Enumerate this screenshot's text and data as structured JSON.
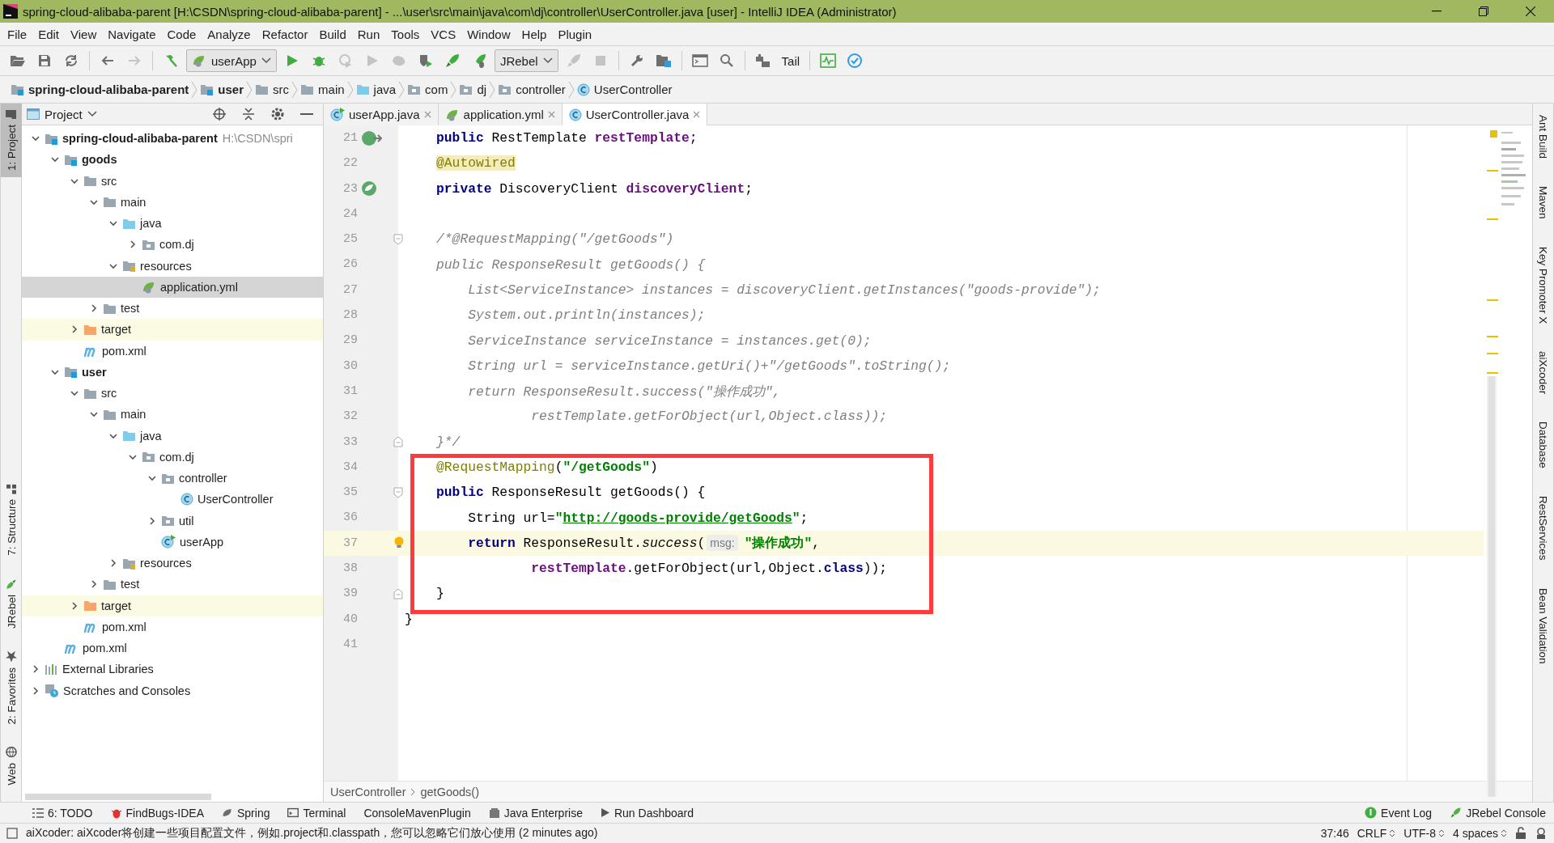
{
  "window": {
    "title": "spring-cloud-alibaba-parent [H:\\CSDN\\spring-cloud-alibaba-parent] - ...\\user\\src\\main\\java\\com\\dj\\controller\\UserController.java [user] - IntelliJ IDEA (Administrator)"
  },
  "menu": [
    "File",
    "Edit",
    "View",
    "Navigate",
    "Code",
    "Analyze",
    "Refactor",
    "Build",
    "Run",
    "Tools",
    "VCS",
    "Window",
    "Help",
    "Plugin"
  ],
  "toolbar": [
    {
      "kind": "open",
      "disabled": false
    },
    {
      "kind": "save",
      "disabled": false
    },
    {
      "kind": "sync",
      "disabled": false
    },
    {
      "kind": "separator"
    },
    {
      "kind": "back",
      "disabled": false
    },
    {
      "kind": "forward",
      "disabled": true
    },
    {
      "kind": "separator"
    },
    {
      "kind": "build",
      "disabled": false
    },
    {
      "kind": "combo",
      "label": "userApp"
    },
    {
      "kind": "run",
      "disabled": false
    },
    {
      "kind": "debug",
      "disabled": false
    },
    {
      "kind": "coverage",
      "disabled": true
    },
    {
      "kind": "run",
      "disabled": true
    },
    {
      "kind": "profile",
      "disabled": true
    },
    {
      "kind": "attach",
      "disabled": false
    },
    {
      "kind": "rocket",
      "disabled": false
    },
    {
      "kind": "rocket-bug",
      "disabled": false
    },
    {
      "kind": "combo",
      "label": "JRebel"
    },
    {
      "kind": "rocket",
      "disabled": true
    },
    {
      "kind": "stop",
      "disabled": true
    },
    {
      "kind": "separator"
    },
    {
      "kind": "wrench",
      "disabled": false
    },
    {
      "kind": "structure",
      "disabled": false
    },
    {
      "kind": "separator"
    },
    {
      "kind": "terminal",
      "disabled": false
    },
    {
      "kind": "search",
      "disabled": false
    },
    {
      "kind": "separator"
    },
    {
      "kind": "vcs",
      "disabled": false
    },
    {
      "kind": "text",
      "label": "Tail"
    },
    {
      "kind": "separator"
    },
    {
      "kind": "monitor",
      "disabled": false
    },
    {
      "kind": "check",
      "disabled": false
    }
  ],
  "breadcrumbs": [
    {
      "label": "spring-cloud-alibaba-parent",
      "kind": "module",
      "bold": true
    },
    {
      "label": "user",
      "kind": "module",
      "bold": true
    },
    {
      "label": "src",
      "kind": "folder",
      "bold": false
    },
    {
      "label": "main",
      "kind": "folder",
      "bold": false
    },
    {
      "label": "java",
      "kind": "source",
      "bold": false
    },
    {
      "label": "com",
      "kind": "package",
      "bold": false
    },
    {
      "label": "dj",
      "kind": "package",
      "bold": false
    },
    {
      "label": "controller",
      "kind": "package",
      "bold": false
    },
    {
      "label": "UserController",
      "kind": "class",
      "bold": false
    }
  ],
  "left_stripe": [
    {
      "label": "1: Project",
      "selected": true,
      "kind": "folder"
    },
    {
      "label": "7: Structure",
      "selected": false,
      "kind": "structure"
    },
    {
      "label": "JRebel",
      "selected": false,
      "kind": "rocket"
    },
    {
      "label": "2: Favorites",
      "selected": false,
      "kind": "star"
    },
    {
      "label": "Web",
      "selected": false,
      "kind": "globe"
    }
  ],
  "project": {
    "title": "Project",
    "tree": [
      {
        "label": "spring-cloud-alibaba-parent",
        "note": "H:\\CSDN\\spri",
        "kind": "module",
        "bold": true,
        "expanded": true,
        "selected": false,
        "excluded": false,
        "children": [
          {
            "label": "goods",
            "kind": "module",
            "bold": true,
            "expanded": true,
            "selected": false,
            "excluded": false,
            "children": [
              {
                "label": "src",
                "kind": "folder",
                "bold": false,
                "expanded": true,
                "selected": false,
                "excluded": false,
                "children": [
                  {
                    "label": "main",
                    "kind": "folder",
                    "bold": false,
                    "expanded": true,
                    "selected": false,
                    "excluded": false,
                    "children": [
                      {
                        "label": "java",
                        "kind": "source",
                        "bold": false,
                        "expanded": true,
                        "selected": false,
                        "excluded": false,
                        "children": [
                          {
                            "label": "com.dj",
                            "kind": "package",
                            "bold": false,
                            "expanded": false,
                            "selected": false,
                            "excluded": false
                          }
                        ]
                      },
                      {
                        "label": "resources",
                        "kind": "resources",
                        "bold": false,
                        "expanded": true,
                        "selected": false,
                        "excluded": false,
                        "children": [
                          {
                            "label": "application.yml",
                            "kind": "yml",
                            "bold": false,
                            "selected": true,
                            "excluded": false
                          }
                        ]
                      }
                    ]
                  },
                  {
                    "label": "test",
                    "kind": "folder",
                    "bold": false,
                    "expanded": false,
                    "selected": false,
                    "excluded": false
                  }
                ]
              },
              {
                "label": "target",
                "kind": "excluded",
                "bold": false,
                "expanded": false,
                "selected": false,
                "excluded": true
              },
              {
                "label": "pom.xml",
                "kind": "maven",
                "bold": false,
                "selected": false,
                "excluded": false
              }
            ]
          },
          {
            "label": "user",
            "kind": "module",
            "bold": true,
            "expanded": true,
            "selected": false,
            "excluded": false,
            "children": [
              {
                "label": "src",
                "kind": "folder",
                "bold": false,
                "expanded": true,
                "selected": false,
                "excluded": false,
                "children": [
                  {
                    "label": "main",
                    "kind": "folder",
                    "bold": false,
                    "expanded": true,
                    "selected": false,
                    "excluded": false,
                    "children": [
                      {
                        "label": "java",
                        "kind": "source",
                        "bold": false,
                        "expanded": true,
                        "selected": false,
                        "excluded": false,
                        "children": [
                          {
                            "label": "com.dj",
                            "kind": "package",
                            "bold": false,
                            "expanded": true,
                            "selected": false,
                            "excluded": false,
                            "children": [
                              {
                                "label": "controller",
                                "kind": "package",
                                "bold": false,
                                "expanded": true,
                                "selected": false,
                                "excluded": false,
                                "children": [
                                  {
                                    "label": "UserController",
                                    "kind": "class",
                                    "bold": false,
                                    "selected": false,
                                    "excluded": false
                                  }
                                ]
                              },
                              {
                                "label": "util",
                                "kind": "package",
                                "bold": false,
                                "expanded": false,
                                "selected": false,
                                "excluded": false
                              },
                              {
                                "label": "userApp",
                                "kind": "app",
                                "bold": false,
                                "selected": false,
                                "excluded": false
                              }
                            ]
                          }
                        ]
                      },
                      {
                        "label": "resources",
                        "kind": "resources",
                        "bold": false,
                        "expanded": false,
                        "selected": false,
                        "excluded": false
                      }
                    ]
                  },
                  {
                    "label": "test",
                    "kind": "folder",
                    "bold": false,
                    "expanded": false,
                    "selected": false,
                    "excluded": false
                  }
                ]
              },
              {
                "label": "target",
                "kind": "excluded",
                "bold": false,
                "expanded": false,
                "selected": false,
                "excluded": true
              },
              {
                "label": "pom.xml",
                "kind": "maven",
                "bold": false,
                "selected": false,
                "excluded": false
              }
            ]
          },
          {
            "label": "pom.xml",
            "kind": "maven",
            "bold": false,
            "selected": false,
            "excluded": false
          }
        ]
      },
      {
        "label": "External Libraries",
        "kind": "libraries",
        "bold": false,
        "expanded": false,
        "selected": false,
        "excluded": false
      },
      {
        "label": "Scratches and Consoles",
        "kind": "scratches",
        "bold": false,
        "expanded": false,
        "selected": false,
        "excluded": false
      }
    ]
  },
  "editor": {
    "tabs": [
      {
        "label": "userApp.java",
        "kind": "app",
        "selected": false
      },
      {
        "label": "application.yml",
        "kind": "yml",
        "selected": false
      },
      {
        "label": "UserController.java",
        "kind": "class",
        "selected": true
      }
    ],
    "lines": [
      {
        "number": "21",
        "kind": "bean-nav",
        "current": false,
        "highlighted": false,
        "tokens": [
          {
            "kind": "keyword",
            "text": "    public"
          },
          {
            "kind": "plain",
            "text": " RestTemplate "
          },
          {
            "kind": "field",
            "text": "restTemplate"
          },
          {
            "kind": "plain",
            "text": ";"
          }
        ]
      },
      {
        "number": "22",
        "kind": "plain",
        "current": false,
        "highlighted": false,
        "tokens": [
          {
            "kind": "annotation-warn",
            "text": "    @Autowired"
          }
        ]
      },
      {
        "number": "23",
        "kind": "bean",
        "current": false,
        "highlighted": false,
        "tokens": [
          {
            "kind": "keyword",
            "text": "    private"
          },
          {
            "kind": "plain",
            "text": " DiscoveryClient "
          },
          {
            "kind": "field",
            "text": "discoveryClient"
          },
          {
            "kind": "plain",
            "text": ";"
          }
        ]
      },
      {
        "number": "24",
        "kind": "plain",
        "current": false,
        "highlighted": false
      },
      {
        "number": "25",
        "kind": "fold-start",
        "current": false,
        "highlighted": false,
        "tokens": [
          {
            "kind": "comment",
            "text": "    /*@RequestMapping(\"/getGoods\")"
          }
        ]
      },
      {
        "number": "26",
        "kind": "plain",
        "current": false,
        "highlighted": false,
        "tokens": [
          {
            "kind": "comment",
            "text": "    public ResponseResult getGoods() {"
          }
        ]
      },
      {
        "number": "27",
        "kind": "plain",
        "current": false,
        "highlighted": false,
        "tokens": [
          {
            "kind": "comment",
            "text": "        List<ServiceInstance> instances = discoveryClient.getInstances(\"goods-provide\");"
          }
        ]
      },
      {
        "number": "28",
        "kind": "plain",
        "current": false,
        "highlighted": false,
        "tokens": [
          {
            "kind": "comment",
            "text": "        System.out.println(instances);"
          }
        ]
      },
      {
        "number": "29",
        "kind": "plain",
        "current": false,
        "highlighted": false,
        "tokens": [
          {
            "kind": "comment",
            "text": "        ServiceInstance serviceInstance = instances.get(0);"
          }
        ]
      },
      {
        "number": "30",
        "kind": "plain",
        "current": false,
        "highlighted": false,
        "tokens": [
          {
            "kind": "comment",
            "text": "        String url = serviceInstance.getUri()+\"/getGoods\".toString();"
          }
        ]
      },
      {
        "number": "31",
        "kind": "plain",
        "current": false,
        "highlighted": false,
        "tokens": [
          {
            "kind": "comment",
            "text": "        return ResponseResult.success(\"操作成功\","
          }
        ]
      },
      {
        "number": "32",
        "kind": "plain",
        "current": false,
        "highlighted": false,
        "tokens": [
          {
            "kind": "comment",
            "text": "                restTemplate.getForObject(url,Object.class));"
          }
        ]
      },
      {
        "number": "33",
        "kind": "fold-end",
        "current": false,
        "highlighted": false,
        "tokens": [
          {
            "kind": "comment",
            "text": "    }*/"
          }
        ]
      },
      {
        "number": "34",
        "kind": "plain",
        "current": false,
        "highlighted": true,
        "tokens": [
          {
            "kind": "annotation",
            "text": "    @RequestMapping"
          },
          {
            "kind": "plain",
            "text": "("
          },
          {
            "kind": "string",
            "text": "\"/getGoods\""
          },
          {
            "kind": "plain",
            "text": ")"
          }
        ]
      },
      {
        "number": "35",
        "kind": "fold-start",
        "current": false,
        "highlighted": true,
        "tokens": [
          {
            "kind": "keyword",
            "text": "    public"
          },
          {
            "kind": "plain",
            "text": " ResponseResult getGoods() {"
          }
        ]
      },
      {
        "number": "36",
        "kind": "plain",
        "current": false,
        "highlighted": true,
        "tokens": [
          {
            "kind": "plain",
            "text": "        String url="
          },
          {
            "kind": "string",
            "text": "\""
          },
          {
            "kind": "link",
            "text": "http://goods-provide/getGoods"
          },
          {
            "kind": "string",
            "text": "\""
          },
          {
            "kind": "plain",
            "text": ";"
          }
        ]
      },
      {
        "number": "37",
        "kind": "bulb",
        "current": true,
        "highlighted": true,
        "tokens": [
          {
            "kind": "keyword",
            "text": "        return"
          },
          {
            "kind": "plain",
            "text": " ResponseResult."
          },
          {
            "kind": "static",
            "text": "success"
          },
          {
            "kind": "plain",
            "text": "("
          },
          {
            "kind": "hint",
            "text": "msg:"
          },
          {
            "kind": "string",
            "text": "\"操作成功\""
          },
          {
            "kind": "plain",
            "text": ","
          }
        ]
      },
      {
        "number": "38",
        "kind": "plain",
        "current": false,
        "highlighted": true,
        "tokens": [
          {
            "kind": "field",
            "text": "                restTemplate"
          },
          {
            "kind": "plain",
            "text": ".getForObject(url,Object."
          },
          {
            "kind": "keyword",
            "text": "class"
          },
          {
            "kind": "plain",
            "text": "));"
          }
        ]
      },
      {
        "number": "39",
        "kind": "fold-end",
        "current": false,
        "highlighted": true,
        "tokens": [
          {
            "kind": "plain",
            "text": "    }"
          }
        ]
      },
      {
        "number": "40",
        "kind": "plain",
        "current": false,
        "highlighted": false,
        "tokens": [
          {
            "kind": "plain",
            "text": "}"
          }
        ]
      },
      {
        "number": "41",
        "kind": "plain",
        "current": false,
        "highlighted": false
      }
    ],
    "breadcrumbs": [
      "UserController",
      "getGoods()"
    ]
  },
  "right_stripe": [
    "Ant Build",
    "Maven",
    "Key Promoter X",
    "aiXcoder",
    "Database",
    "RestServices",
    "Bean Validation"
  ],
  "tool_windows": {
    "left": [
      {
        "label": "6: TODO",
        "kind": "list"
      },
      {
        "label": "FindBugs-IDEA",
        "kind": "bug"
      },
      {
        "label": "Spring",
        "kind": "leaf"
      },
      {
        "label": "Terminal",
        "kind": "terminal"
      },
      {
        "label": "ConsoleMavenPlugin",
        "kind": "plain"
      },
      {
        "label": "Java Enterprise",
        "kind": "enterprise"
      },
      {
        "label": "Run Dashboard",
        "kind": "play"
      }
    ],
    "right": [
      {
        "label": "Event Log",
        "kind": "event"
      },
      {
        "label": "JRebel Console",
        "kind": "rocket"
      }
    ]
  },
  "status_bar": {
    "message": "aiXcoder: aiXcoder将创建一些项目配置文件，例如.project和.classpath，您可以忽略它们放心使用 (2 minutes ago)",
    "position": "37:46",
    "line_separator": "CRLF",
    "encoding": "UTF-8",
    "indent": "4 spaces"
  }
}
